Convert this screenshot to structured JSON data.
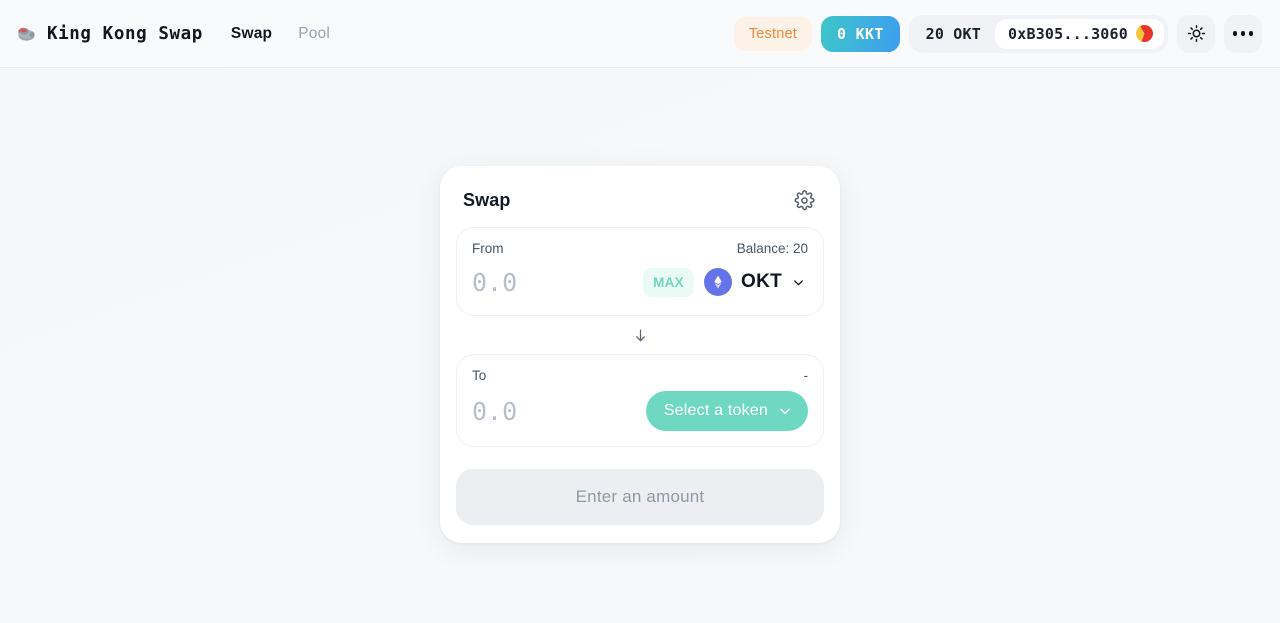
{
  "header": {
    "brand": {
      "logo_icon": "gorilla-icon",
      "name": "King Kong Swap"
    },
    "nav": [
      {
        "label": "Swap",
        "active": true
      },
      {
        "label": "Pool",
        "active": false
      }
    ],
    "network_badge": "Testnet",
    "token_badge": "0 KKT",
    "wallet": {
      "balance": "20 OKT",
      "address": "0xB305...3060",
      "avatar_icon": "wallet-avatar-icon"
    },
    "theme_toggle_icon": "sun-icon",
    "more_menu_icon": "ellipsis-icon"
  },
  "swap": {
    "title": "Swap",
    "settings_icon": "gear-icon",
    "from": {
      "label": "From",
      "meta": "Balance: 20",
      "amount_value": "",
      "amount_placeholder": "0.0",
      "max_label": "MAX",
      "token_symbol": "OKT",
      "token_icon": "ethereum-diamond-icon",
      "chevron_icon": "chevron-down-icon"
    },
    "direction_icon": "arrow-down-icon",
    "to": {
      "label": "To",
      "meta": "-",
      "amount_value": "",
      "amount_placeholder": "0.0",
      "select_token_label": "Select a token",
      "chevron_icon": "chevron-down-icon"
    },
    "submit_label": "Enter an amount"
  },
  "colors": {
    "accent_teal": "#6fd8c0",
    "accent_blue": "#3d9ef0",
    "testnet_orange": "#f5883a",
    "token_icon_blue": "#6274e8",
    "page_bg": "#f4f7f8"
  }
}
